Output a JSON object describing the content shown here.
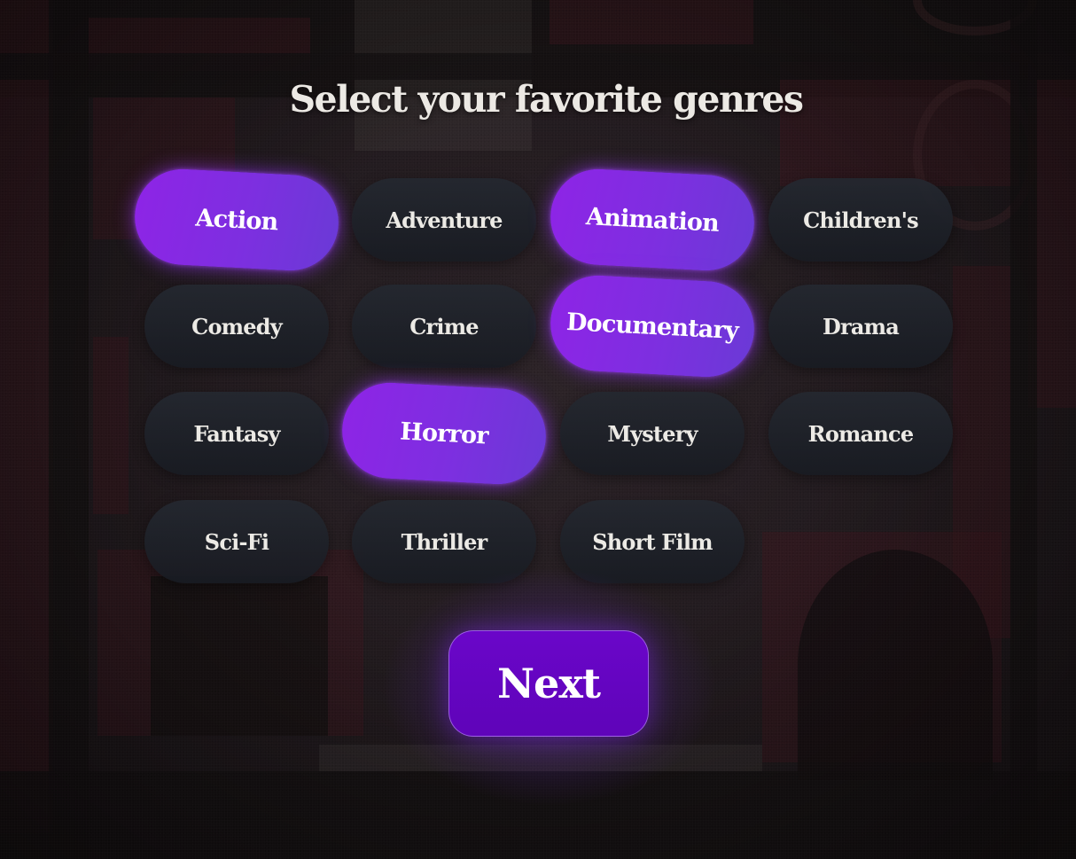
{
  "page": {
    "title": "Select your favorite genres",
    "next_label": "Next"
  },
  "genres": [
    {
      "label": "Action",
      "selected": true
    },
    {
      "label": "Adventure",
      "selected": false
    },
    {
      "label": "Animation",
      "selected": true
    },
    {
      "label": "Children's",
      "selected": false
    },
    {
      "label": "Comedy",
      "selected": false
    },
    {
      "label": "Crime",
      "selected": false
    },
    {
      "label": "Documentary",
      "selected": true
    },
    {
      "label": "Drama",
      "selected": false
    },
    {
      "label": "Fantasy",
      "selected": false
    },
    {
      "label": "Horror",
      "selected": true
    },
    {
      "label": "Mystery",
      "selected": false
    },
    {
      "label": "Romance",
      "selected": false
    },
    {
      "label": "Sci-Fi",
      "selected": false
    },
    {
      "label": "Thriller",
      "selected": false
    },
    {
      "label": "Short Film",
      "selected": false
    }
  ],
  "colors": {
    "selected_pill": "#8e24e6",
    "unselected_pill": "#1e2229",
    "next_button": "#6a06c9",
    "text": "#eceae5"
  }
}
